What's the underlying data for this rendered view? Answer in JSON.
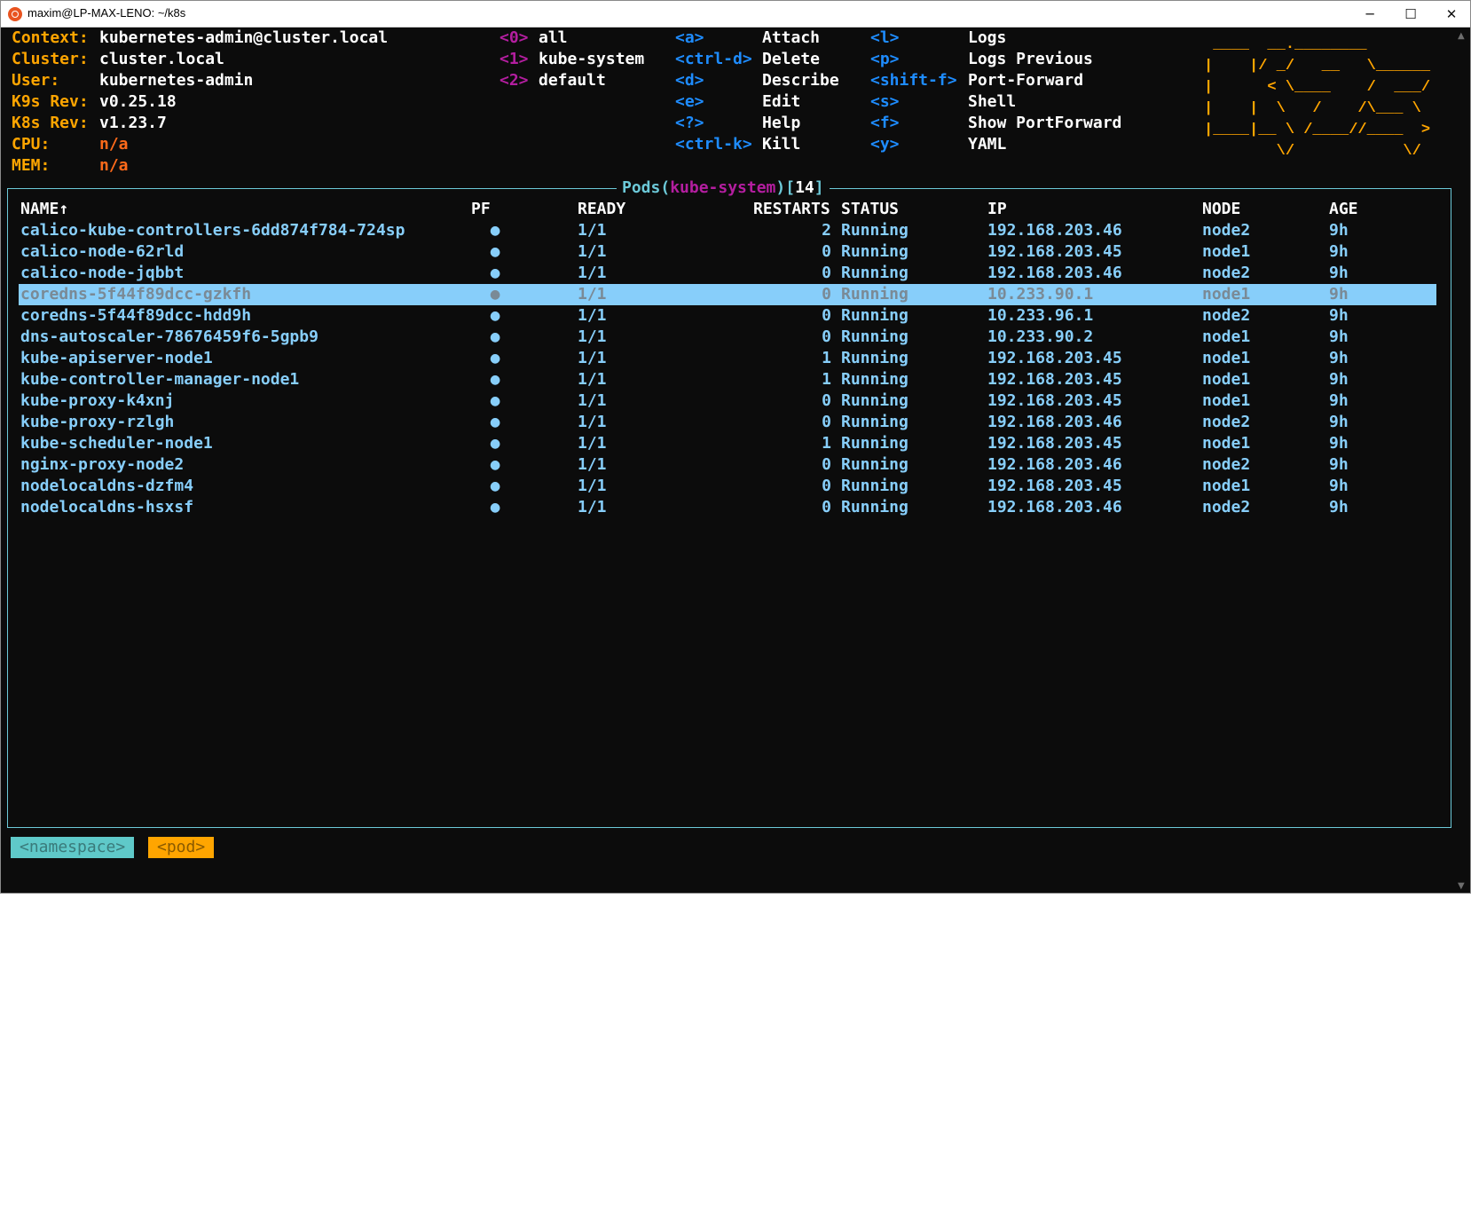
{
  "window": {
    "title": "maxim@LP-MAX-LENO: ~/k8s",
    "controls": {
      "minimize": "─",
      "maximize": "☐",
      "close": "✕"
    }
  },
  "info": [
    {
      "label": "Context:",
      "value": "kubernetes-admin@cluster.local"
    },
    {
      "label": "Cluster:",
      "value": "cluster.local"
    },
    {
      "label": "User:",
      "value": "kubernetes-admin"
    },
    {
      "label": "K9s Rev:",
      "value": "v0.25.18"
    },
    {
      "label": "K8s Rev:",
      "value": "v1.23.7"
    },
    {
      "label": "CPU:",
      "value": "n/a"
    },
    {
      "label": "MEM:",
      "value": "n/a"
    }
  ],
  "namespaces": [
    {
      "key": "<0>",
      "name": "all"
    },
    {
      "key": "<1>",
      "name": "kube-system"
    },
    {
      "key": "<2>",
      "name": "default"
    }
  ],
  "shortcuts_left": [
    {
      "key": "<a>",
      "action": "Attach"
    },
    {
      "key": "<ctrl-d>",
      "action": "Delete"
    },
    {
      "key": "<d>",
      "action": "Describe"
    },
    {
      "key": "<e>",
      "action": "Edit"
    },
    {
      "key": "<?>",
      "action": "Help"
    },
    {
      "key": "<ctrl-k>",
      "action": "Kill"
    }
  ],
  "shortcuts_right": [
    {
      "key": "<l>",
      "action": "Logs"
    },
    {
      "key": "<p>",
      "action": "Logs Previous"
    },
    {
      "key": "<shift-f>",
      "action": "Port-Forward"
    },
    {
      "key": "<s>",
      "action": "Shell"
    },
    {
      "key": "<f>",
      "action": "Show PortForward"
    },
    {
      "key": "<y>",
      "action": "YAML"
    }
  ],
  "logo": " ____  __.________        \n|    |/ _/   __   \\______\n|      < \\____    /  ___/\n|    |  \\   /    /\\___ \\ \n|____|__ \\ /____//____  >\n        \\/            \\/ ",
  "panel": {
    "title_prefix": "Pods(",
    "namespace": "kube-system",
    "title_mid": ")[",
    "count": "14",
    "title_suffix": "]"
  },
  "columns": {
    "name": "NAME↑",
    "pf": "PF",
    "ready": "READY",
    "restarts": "RESTARTS",
    "status": "STATUS",
    "ip": "IP",
    "node": "NODE",
    "age": "AGE"
  },
  "pods": [
    {
      "name": "calico-kube-controllers-6dd874f784-724sp",
      "pf": "●",
      "ready": "1/1",
      "restarts": "2",
      "status": "Running",
      "ip": "192.168.203.46",
      "node": "node2",
      "age": "9h"
    },
    {
      "name": "calico-node-62rld",
      "pf": "●",
      "ready": "1/1",
      "restarts": "0",
      "status": "Running",
      "ip": "192.168.203.45",
      "node": "node1",
      "age": "9h"
    },
    {
      "name": "calico-node-jqbbt",
      "pf": "●",
      "ready": "1/1",
      "restarts": "0",
      "status": "Running",
      "ip": "192.168.203.46",
      "node": "node2",
      "age": "9h"
    },
    {
      "name": "coredns-5f44f89dcc-gzkfh",
      "pf": "●",
      "ready": "1/1",
      "restarts": "0",
      "status": "Running",
      "ip": "10.233.90.1",
      "node": "node1",
      "age": "9h",
      "selected": true
    },
    {
      "name": "coredns-5f44f89dcc-hdd9h",
      "pf": "●",
      "ready": "1/1",
      "restarts": "0",
      "status": "Running",
      "ip": "10.233.96.1",
      "node": "node2",
      "age": "9h"
    },
    {
      "name": "dns-autoscaler-78676459f6-5gpb9",
      "pf": "●",
      "ready": "1/1",
      "restarts": "0",
      "status": "Running",
      "ip": "10.233.90.2",
      "node": "node1",
      "age": "9h"
    },
    {
      "name": "kube-apiserver-node1",
      "pf": "●",
      "ready": "1/1",
      "restarts": "1",
      "status": "Running",
      "ip": "192.168.203.45",
      "node": "node1",
      "age": "9h"
    },
    {
      "name": "kube-controller-manager-node1",
      "pf": "●",
      "ready": "1/1",
      "restarts": "1",
      "status": "Running",
      "ip": "192.168.203.45",
      "node": "node1",
      "age": "9h"
    },
    {
      "name": "kube-proxy-k4xnj",
      "pf": "●",
      "ready": "1/1",
      "restarts": "0",
      "status": "Running",
      "ip": "192.168.203.45",
      "node": "node1",
      "age": "9h"
    },
    {
      "name": "kube-proxy-rzlgh",
      "pf": "●",
      "ready": "1/1",
      "restarts": "0",
      "status": "Running",
      "ip": "192.168.203.46",
      "node": "node2",
      "age": "9h"
    },
    {
      "name": "kube-scheduler-node1",
      "pf": "●",
      "ready": "1/1",
      "restarts": "1",
      "status": "Running",
      "ip": "192.168.203.45",
      "node": "node1",
      "age": "9h"
    },
    {
      "name": "nginx-proxy-node2",
      "pf": "●",
      "ready": "1/1",
      "restarts": "0",
      "status": "Running",
      "ip": "192.168.203.46",
      "node": "node2",
      "age": "9h"
    },
    {
      "name": "nodelocaldns-dzfm4",
      "pf": "●",
      "ready": "1/1",
      "restarts": "0",
      "status": "Running",
      "ip": "192.168.203.45",
      "node": "node1",
      "age": "9h"
    },
    {
      "name": "nodelocaldns-hsxsf",
      "pf": "●",
      "ready": "1/1",
      "restarts": "0",
      "status": "Running",
      "ip": "192.168.203.46",
      "node": "node2",
      "age": "9h"
    }
  ],
  "crumbs": {
    "namespace": "<namespace>",
    "pod": "<pod>"
  }
}
